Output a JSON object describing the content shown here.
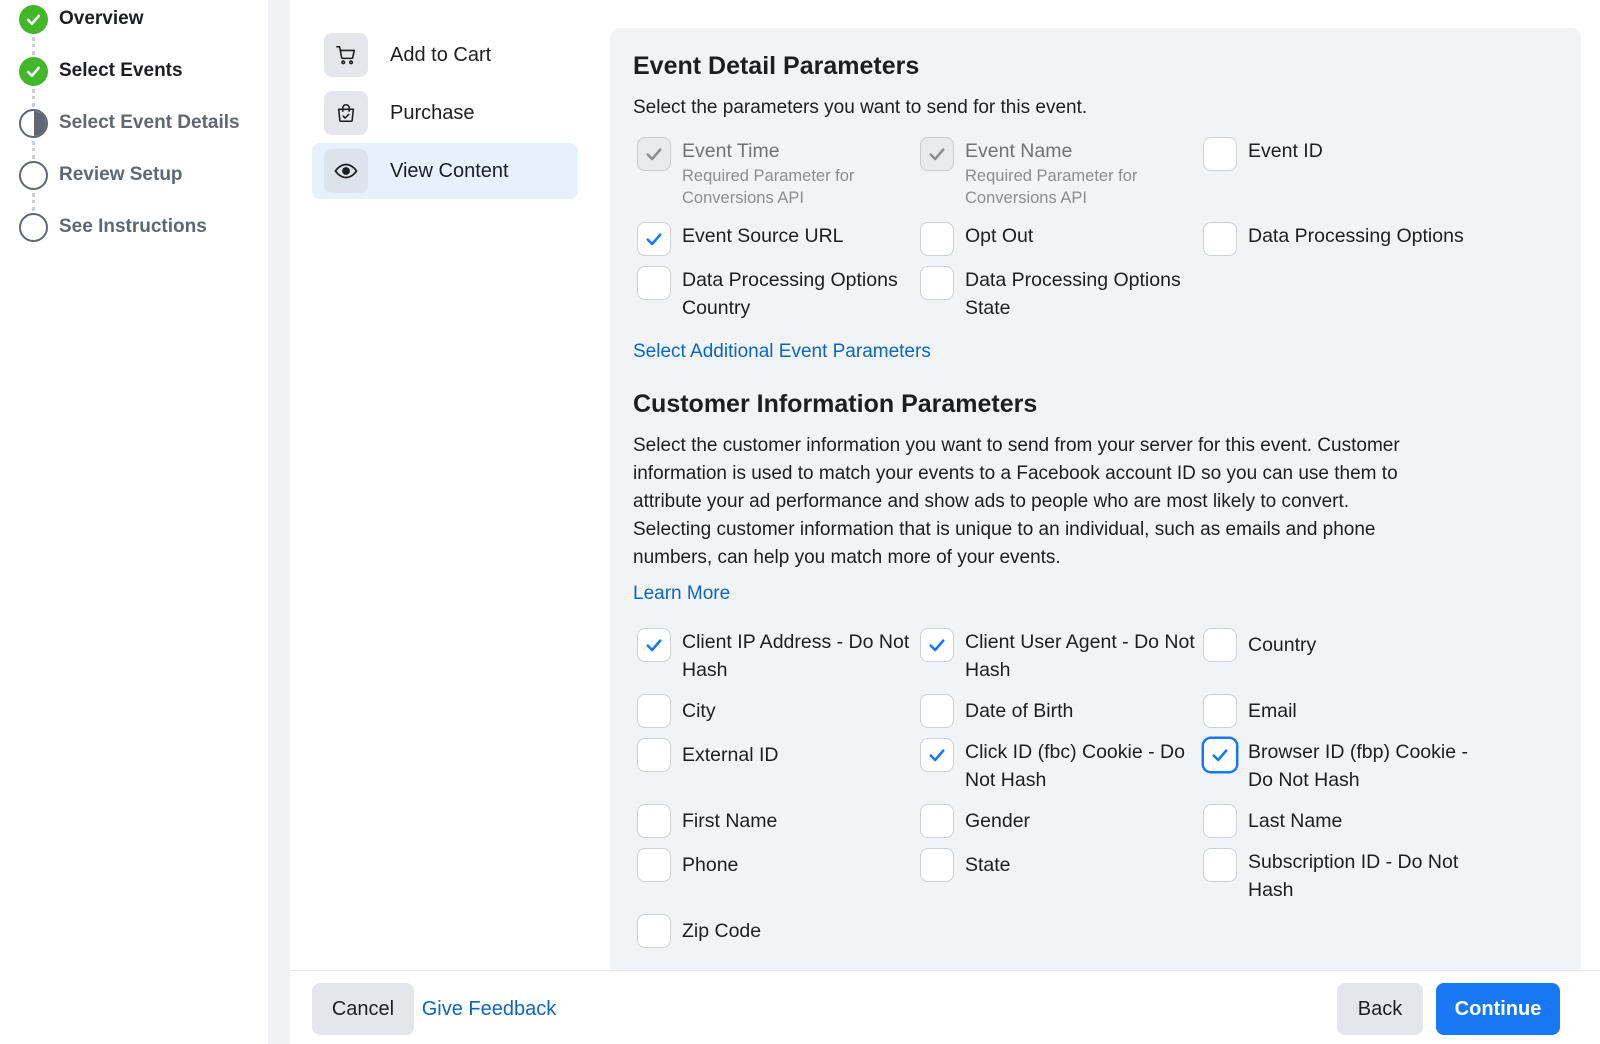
{
  "stepper": {
    "steps": [
      {
        "label": "Overview",
        "state": "done"
      },
      {
        "label": "Select Events",
        "state": "done"
      },
      {
        "label": "Select Event Details",
        "state": "current"
      },
      {
        "label": "Review Setup",
        "state": "todo"
      },
      {
        "label": "See Instructions",
        "state": "todo"
      }
    ]
  },
  "events": {
    "items": [
      {
        "label": "Add to Cart",
        "icon": "cart-icon",
        "selected": false
      },
      {
        "label": "Purchase",
        "icon": "shopping-bag-icon",
        "selected": false
      },
      {
        "label": "View Content",
        "icon": "eye-icon",
        "selected": true
      }
    ]
  },
  "event_detail": {
    "title": "Event Detail Parameters",
    "description": "Select the parameters you want to send for this event.",
    "params": [
      {
        "label": "Event Time",
        "sublabel": "Required Parameter for Conversions API",
        "checked": true,
        "disabled": true
      },
      {
        "label": "Event Name",
        "sublabel": "Required Parameter for Conversions API",
        "checked": true,
        "disabled": true
      },
      {
        "label": "Event ID",
        "checked": false
      },
      {
        "label": "Event Source URL",
        "checked": true
      },
      {
        "label": "Opt Out",
        "checked": false
      },
      {
        "label": "Data Processing Options",
        "checked": false
      },
      {
        "label": "Data Processing Options Country",
        "checked": false
      },
      {
        "label": "Data Processing Options State",
        "checked": false
      }
    ],
    "additional_link": "Select Additional Event Parameters"
  },
  "customer_info": {
    "title": "Customer Information Parameters",
    "description_lines": [
      "Select the customer information you want to send from your server for this event. Customer",
      "information is used to match your events to a Facebook account ID so you can use them to",
      "attribute your ad performance and show ads to people who are most likely to convert.",
      "Selecting customer information that is unique to an individual, such as emails and phone",
      "numbers, can help you match more of your events."
    ],
    "learn_more": "Learn More",
    "params": [
      {
        "label": "Client IP Address - Do Not Hash",
        "checked": true
      },
      {
        "label": "Client User Agent - Do Not Hash",
        "checked": true
      },
      {
        "label": "Country",
        "checked": false
      },
      {
        "label": "City",
        "checked": false
      },
      {
        "label": "Date of Birth",
        "checked": false
      },
      {
        "label": "Email",
        "checked": false
      },
      {
        "label": "External ID",
        "checked": false
      },
      {
        "label": "Click ID (fbc) Cookie - Do Not Hash",
        "checked": true
      },
      {
        "label": "Browser ID (fbp) Cookie - Do Not Hash",
        "checked": true,
        "focused": true
      },
      {
        "label": "First Name",
        "checked": false
      },
      {
        "label": "Gender",
        "checked": false
      },
      {
        "label": "Last Name",
        "checked": false
      },
      {
        "label": "Phone",
        "checked": false
      },
      {
        "label": "State",
        "checked": false
      },
      {
        "label": "Subscription ID - Do Not Hash",
        "checked": false
      },
      {
        "label": "Zip Code",
        "checked": false
      }
    ]
  },
  "footer": {
    "cancel": "Cancel",
    "feedback": "Give Feedback",
    "back": "Back",
    "continue": "Continue"
  },
  "colors": {
    "accent": "#1877f2",
    "link": "#0a66c2",
    "success": "#42b72a",
    "panel_bg": "#f2f3f5"
  }
}
